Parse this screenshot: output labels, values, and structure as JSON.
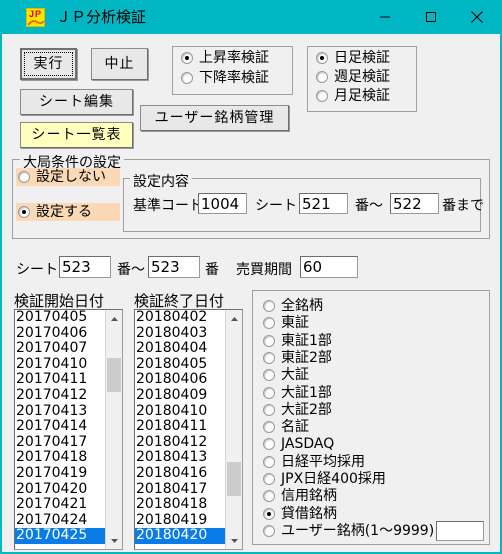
{
  "window": {
    "title": "ＪＰ分析検証",
    "icon": "jp-app-icon",
    "accent_color": "#00b7c3",
    "background_color": "#f0f0f0",
    "controls": {
      "minimize": "minimize-icon",
      "maximize": "maximize-icon",
      "close": "close-icon"
    }
  },
  "toolbar": {
    "run_label": "実行",
    "stop_label": "中止",
    "sheet_edit_label": "シート編集",
    "sheet_list_label": "シート一覧表",
    "user_stock_manage_label": "ユーザー銘柄管理",
    "sheet_list_color": "#ffffc0"
  },
  "rate_group": {
    "options": [
      {
        "label": "上昇率検証",
        "checked": true
      },
      {
        "label": "下降率検証",
        "checked": false
      }
    ]
  },
  "period_group": {
    "options": [
      {
        "label": "日足検証",
        "checked": true
      },
      {
        "label": "週足検証",
        "checked": false
      },
      {
        "label": "月足検証",
        "checked": false
      }
    ]
  },
  "global_condition": {
    "legend": "大局条件の設定",
    "highlight_color": "#fbd9b6",
    "options": [
      {
        "label": "設定しない",
        "checked": false
      },
      {
        "label": "設定する",
        "checked": true
      }
    ],
    "content": {
      "legend": "設定内容",
      "base_code_label": "基準コード",
      "base_code_value": "1004",
      "sheet_label": "シート",
      "sheet_from_value": "521",
      "range_label": "番～",
      "sheet_to_value": "522",
      "suffix_label": "番まで"
    }
  },
  "sheet_row": {
    "sheet_label": "シート",
    "sheet_from_value": "523",
    "range_label": "番～",
    "sheet_to_value": "523",
    "suffix_label": "番",
    "trade_period_label": "売買期間",
    "trade_period_value": "60"
  },
  "start_date_list": {
    "label": "検証開始日付",
    "items": [
      "20170405",
      "20170406",
      "20170407",
      "20170410",
      "20170411",
      "20170412",
      "20170413",
      "20170414",
      "20170417",
      "20170418",
      "20170419",
      "20170420",
      "20170421",
      "20170424",
      "20170425"
    ],
    "selected_index": 14,
    "scroll_thumb_top_pct": 18
  },
  "end_date_list": {
    "label": "検証終了日付",
    "items": [
      "20180402",
      "20180403",
      "20180404",
      "20180405",
      "20180406",
      "20180409",
      "20180410",
      "20180411",
      "20180412",
      "20180413",
      "20180416",
      "20180417",
      "20180418",
      "20180419",
      "20180420"
    ],
    "selected_index": 14,
    "scroll_thumb_top_pct": 79
  },
  "market_group": {
    "options": [
      {
        "label": "全銘柄",
        "checked": false
      },
      {
        "label": "東証",
        "checked": false
      },
      {
        "label": "東証1部",
        "checked": false
      },
      {
        "label": "東証2部",
        "checked": false
      },
      {
        "label": "大証",
        "checked": false
      },
      {
        "label": "大証1部",
        "checked": false
      },
      {
        "label": "大証2部",
        "checked": false
      },
      {
        "label": "名証",
        "checked": false
      },
      {
        "label": "JASDAQ",
        "checked": false
      },
      {
        "label": "日経平均採用",
        "checked": false
      },
      {
        "label": "JPX日経400採用",
        "checked": false
      },
      {
        "label": "信用銘柄",
        "checked": false
      },
      {
        "label": "貸借銘柄",
        "checked": true
      },
      {
        "label": "ユーザー銘柄(1～9999)",
        "checked": false
      }
    ],
    "user_stock_input_value": "",
    "selected_index": 12
  }
}
